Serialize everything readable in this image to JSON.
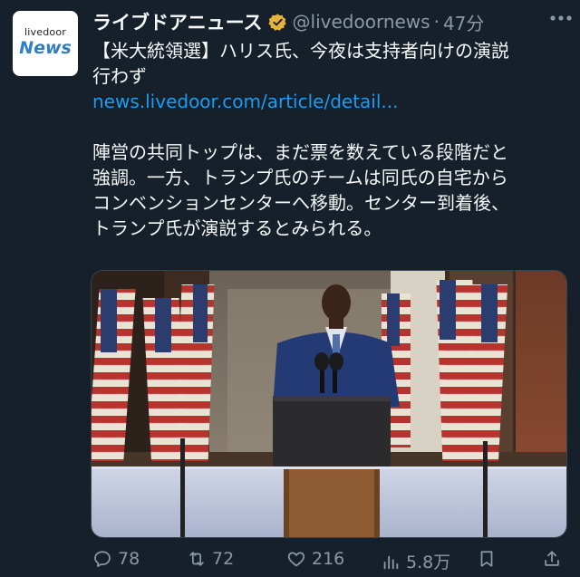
{
  "avatar": {
    "brand_small": "livedoor",
    "brand_big": "News"
  },
  "header": {
    "display_name": "ライブドアニュース",
    "handle": "@livedoornews",
    "separator": "·",
    "time": "47分"
  },
  "tweet": {
    "lines": [
      "【米大統領選】ハリス氏、今夜は支持者向けの演説",
      "行わず"
    ],
    "link": "news.livedoor.com/article/detail...",
    "body_lines": [
      "陣営の共同トップは、まだ票を数えている段階だと",
      "強調。一方、トランプ氏のチームは同氏の自宅から",
      "コンベンションセンターへ移動。センター到着後、",
      "トランプ氏が演説するとみられる。"
    ]
  },
  "actions": {
    "replies": "78",
    "retweets": "72",
    "likes": "216",
    "views": "5.8万"
  },
  "colors": {
    "background": "#15202b",
    "link": "#1d9bf0",
    "muted": "#8b98a5",
    "verified": "#e8b339"
  }
}
